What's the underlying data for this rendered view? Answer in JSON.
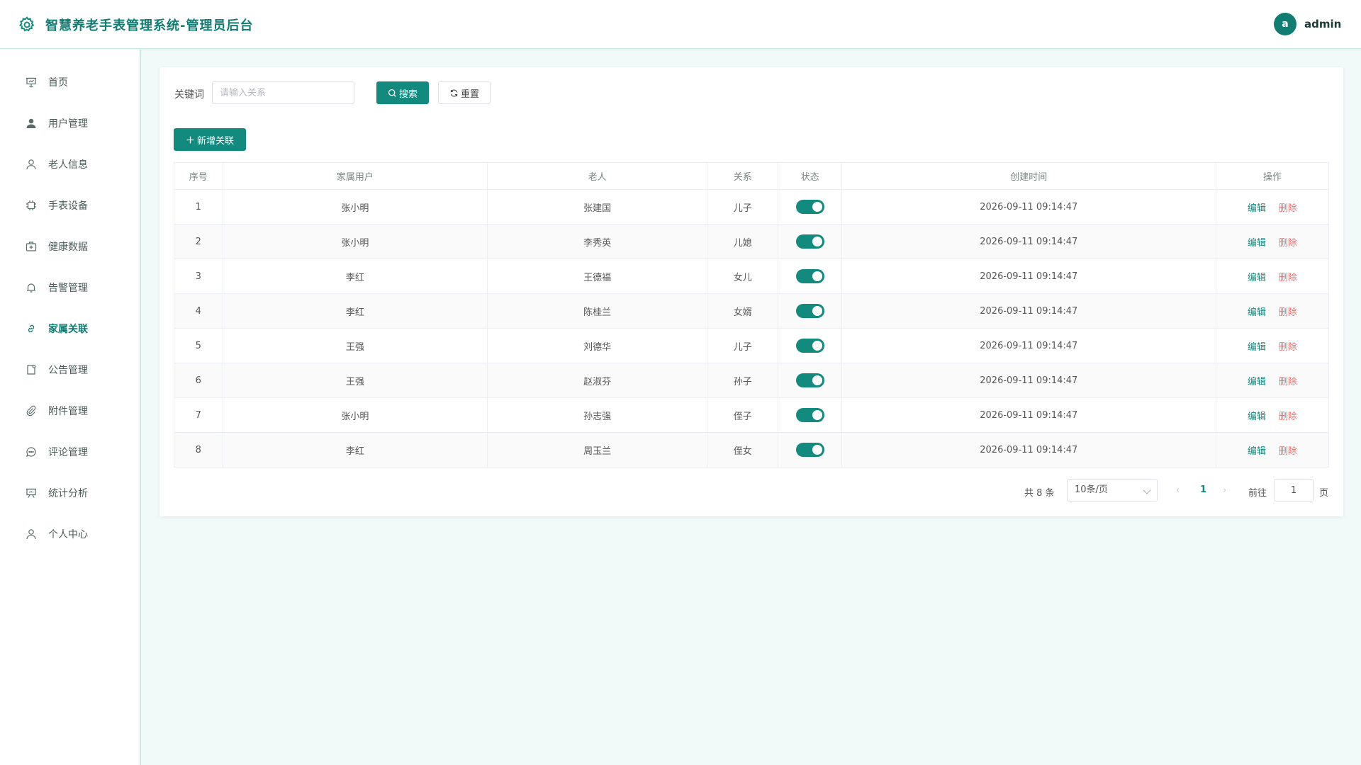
{
  "header": {
    "title": "智慧养老手表管理系统-管理员后台",
    "avatar_letter": "a",
    "username": "admin"
  },
  "sidebar": {
    "items": [
      {
        "label": "首页",
        "icon": "home-chart-icon",
        "active": false
      },
      {
        "label": "用户管理",
        "icon": "user-filled-icon",
        "active": false
      },
      {
        "label": "老人信息",
        "icon": "user-icon",
        "active": false
      },
      {
        "label": "手表设备",
        "icon": "cpu-icon",
        "active": false
      },
      {
        "label": "健康数据",
        "icon": "first-aid-kit-icon",
        "active": false
      },
      {
        "label": "告警管理",
        "icon": "bell-icon",
        "active": false
      },
      {
        "label": "家属关联",
        "icon": "link-icon",
        "active": true
      },
      {
        "label": "公告管理",
        "icon": "notebook-icon",
        "active": false
      },
      {
        "label": "附件管理",
        "icon": "paperclip-icon",
        "active": false
      },
      {
        "label": "评论管理",
        "icon": "chat-icon",
        "active": false
      },
      {
        "label": "统计分析",
        "icon": "presentation-chart-icon",
        "active": false
      },
      {
        "label": "个人中心",
        "icon": "user-icon",
        "active": false
      }
    ]
  },
  "search": {
    "label": "关键词",
    "placeholder": "请输入关系",
    "value": "",
    "search_label": "搜索",
    "reset_label": "重置"
  },
  "actions": {
    "add_label": "新增关联"
  },
  "table": {
    "columns": [
      "序号",
      "家属用户",
      "老人",
      "关系",
      "状态",
      "创建时间",
      "操作"
    ],
    "edit_label": "编辑",
    "delete_label": "删除",
    "rows": [
      {
        "no": "1",
        "family": "张小明",
        "elder": "张建国",
        "relation": "儿子",
        "status": true,
        "created": "2026-09-11 09:14:47"
      },
      {
        "no": "2",
        "family": "张小明",
        "elder": "李秀英",
        "relation": "儿媳",
        "status": true,
        "created": "2026-09-11 09:14:47"
      },
      {
        "no": "3",
        "family": "李红",
        "elder": "王德福",
        "relation": "女儿",
        "status": true,
        "created": "2026-09-11 09:14:47"
      },
      {
        "no": "4",
        "family": "李红",
        "elder": "陈桂兰",
        "relation": "女婿",
        "status": true,
        "created": "2026-09-11 09:14:47"
      },
      {
        "no": "5",
        "family": "王强",
        "elder": "刘德华",
        "relation": "儿子",
        "status": true,
        "created": "2026-09-11 09:14:47"
      },
      {
        "no": "6",
        "family": "王强",
        "elder": "赵淑芬",
        "relation": "孙子",
        "status": true,
        "created": "2026-09-11 09:14:47"
      },
      {
        "no": "7",
        "family": "张小明",
        "elder": "孙志强",
        "relation": "侄子",
        "status": true,
        "created": "2026-09-11 09:14:47"
      },
      {
        "no": "8",
        "family": "李红",
        "elder": "周玉兰",
        "relation": "侄女",
        "status": true,
        "created": "2026-09-11 09:14:47"
      }
    ]
  },
  "pagination": {
    "total_text": "共 8 条",
    "page_size": "10条/页",
    "current_page": "1",
    "goto_label": "前往",
    "goto_value": "1",
    "page_unit": "页"
  },
  "colors": {
    "primary": "#138a7e",
    "danger": "#f56c6c",
    "background": "#f1faf9"
  }
}
